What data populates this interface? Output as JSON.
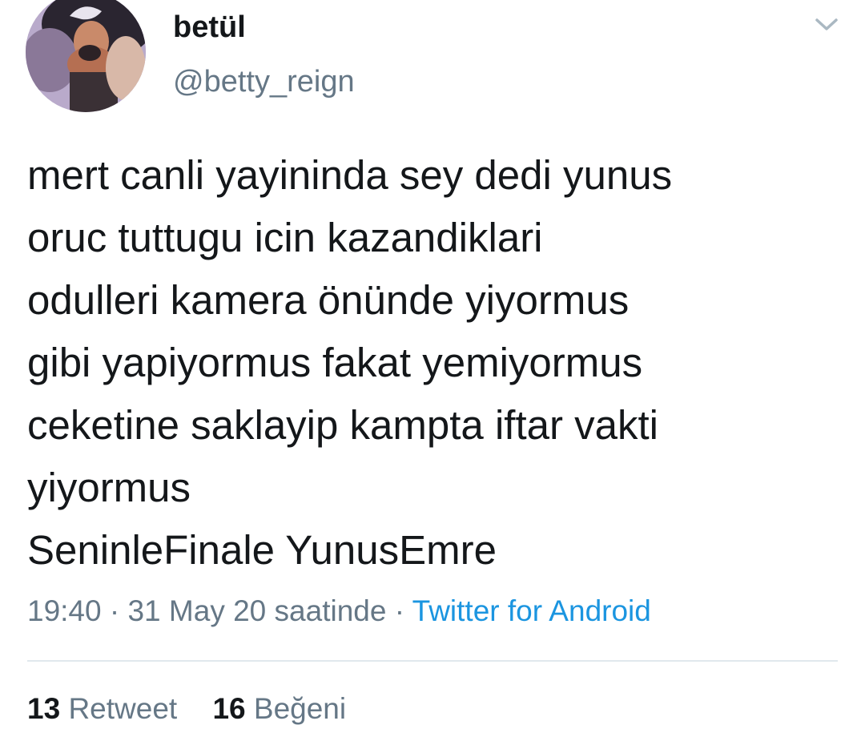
{
  "tweet": {
    "author": {
      "display_name": "betül",
      "handle": "@betty_reign"
    },
    "text_lines": [
      "mert canli yayininda sey dedi yunus",
      "oruc tuttugu icin kazandiklari",
      "odulleri kamera önünde yiyormus",
      "gibi yapiyormus fakat yemiyormus",
      "ceketine saklayip kampta iftar vakti",
      "yiyormus",
      "SeninleFinale YunusEmre"
    ],
    "meta": {
      "time": "19:40",
      "separator": "·",
      "date": "31 May 20 saatinde",
      "source": "Twitter for Android"
    },
    "stats": {
      "retweet_count": "13",
      "retweet_label": "Retweet",
      "like_count": "16",
      "like_label": "Beğeni"
    }
  },
  "icons": {
    "caret": "chevron-down-icon"
  },
  "colors": {
    "primary_text": "#14171a",
    "secondary_text": "#657786",
    "link": "#1b95e0",
    "divider": "#e1e8ed"
  }
}
